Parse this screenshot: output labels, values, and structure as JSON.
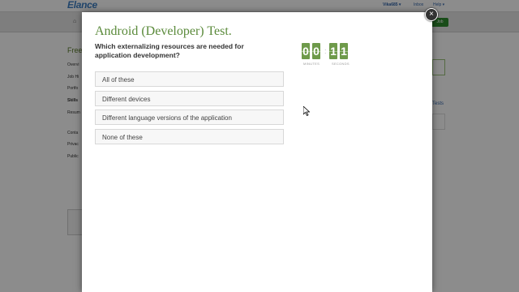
{
  "background": {
    "logo": "Elance",
    "user": "Vika685 ▾",
    "inbox": "Inbox",
    "help": "Help ▾",
    "home_icon": "home-icon",
    "post_job": "Job",
    "sidebar_title": "Free",
    "sidebar_items": [
      "Overvi",
      "Job Hi",
      "Portfo",
      "Skills",
      "Resum",
      "Conta",
      "Privac",
      "Public"
    ],
    "right_link": "Tests"
  },
  "modal": {
    "title": "Android (Developer) Test.",
    "question": "Which externalizing resources are needed for application development?",
    "answers": [
      "All of these",
      "Different devices",
      "Different language versions of the application",
      "None of these"
    ],
    "timer": {
      "minutes": [
        "0",
        "0"
      ],
      "seconds": [
        "1",
        "1"
      ],
      "separator": ":",
      "minutes_label": "MINUTES",
      "seconds_label": "SECONDS"
    },
    "close_symbol": "×"
  },
  "colors": {
    "accent_green": "#6e9a4a",
    "title_green": "#5a8a3a",
    "overlay": "rgba(0,0,0,0.45)"
  }
}
